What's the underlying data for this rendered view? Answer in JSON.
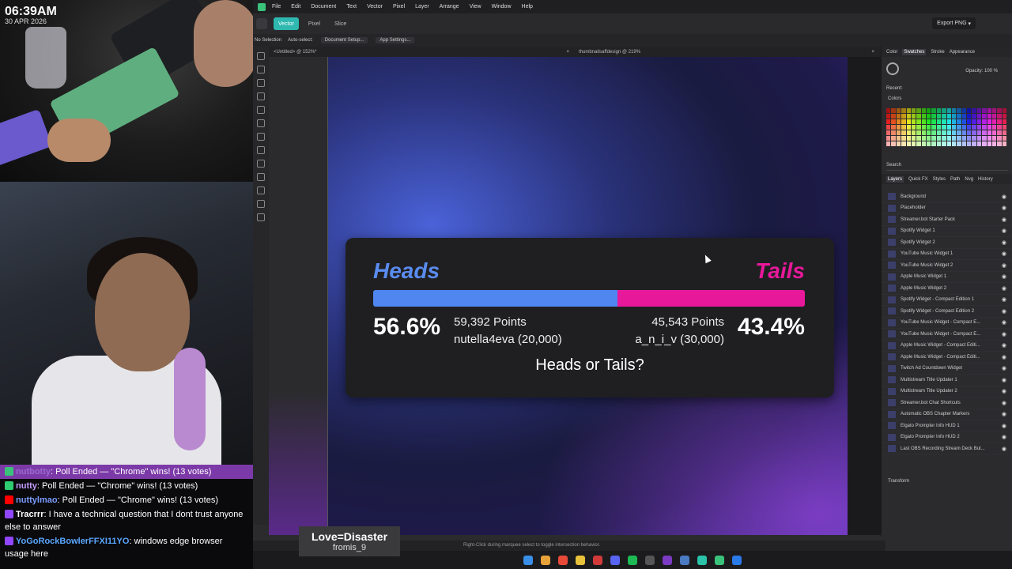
{
  "overlay": {
    "time": "06:39AM",
    "date": "30 APR 2026"
  },
  "chat": [
    {
      "user": "nutbotty",
      "text": ": Poll Ended — \"Chrome\" wins! (13 votes)",
      "user_color": "#9b6bd0",
      "highlight": true
    },
    {
      "user": "nutty",
      "text": ": Poll Ended — \"Chrome\" wins! (13 votes)",
      "user_color": "#c49bff",
      "highlight": false
    },
    {
      "user": "nuttylmao",
      "text": ": Poll Ended — \"Chrome\" wins! (13 votes)",
      "user_color": "#7a9cff",
      "highlight": false
    },
    {
      "user": "Tracrrr",
      "text": ": I have a technical question that I dont trust anyone else to answer",
      "user_color": "#ffffff",
      "highlight": false
    },
    {
      "user": "YoGoRockBowlerFFXI11YO",
      "text": ": windows edge browser usage here",
      "user_color": "#5aa6ff",
      "highlight": false
    }
  ],
  "app": {
    "menu": [
      "File",
      "Edit",
      "Document",
      "Text",
      "Vector",
      "Pixel",
      "Layer",
      "Arrange",
      "View",
      "Window",
      "Help"
    ],
    "personas": [
      "Vector",
      "Pixel",
      "Slice"
    ],
    "export_label": "Export PNG",
    "context": {
      "selection": "No Selection",
      "autoselect": "Auto-select:",
      "doc_setup": "Document Setup...",
      "app_settings": "App Settings..."
    },
    "tabs": [
      "<Untitled> @ 152%*",
      "thumbnailsaffdesign @ 219%"
    ],
    "panel_tabs_top": [
      "Color",
      "Swatches",
      "Stroke",
      "Appearance"
    ],
    "opacity_label": "Opacity:",
    "opacity_value": "100 %",
    "recent_label": "Recent:",
    "colors_label": "Colors",
    "search_placeholder": "Search",
    "panel_tabs_layers": [
      "Layers",
      "Quick FX",
      "Styles",
      "Path",
      "Nvg",
      "History"
    ],
    "layers": [
      "Background",
      "Placeholder",
      "Streamer.bot Starter Pack",
      "Spotify Widget 1",
      "Spotify Widget 2",
      "YouTube Music Widget 1",
      "YouTube Music Widget 2",
      "Apple Music Widget 1",
      "Apple Music Widget 2",
      "Spotify Widget - Compact Edition 1",
      "Spotify Widget - Compact Edition 2",
      "YouTube Music Widget - Compact E...",
      "YouTube Music Widget - Compact E...",
      "Apple Music Widget - Compact Editi...",
      "Apple Music Widget - Compact Editi...",
      "Twitch Ad Countdown Widget",
      "Multistream Title Updater 1",
      "Multistream Title Updater 2",
      "Streamer.bot Chat Shortcuts",
      "Automatic OBS Chapter Markers",
      "Elgato Prompter Info HUD 1",
      "Elgato Prompter Info HUD 2",
      "Last OBS Recording Stream Deck But..."
    ],
    "transform_label": "Transform",
    "status_hint": "Right-Click during marquee select to toggle intersection behavior."
  },
  "poll": {
    "left_label": "Heads",
    "right_label": "Tails",
    "left_percent": "56.6%",
    "right_percent": "43.4%",
    "left_fraction": 0.566,
    "left_points": "59,392 Points",
    "right_points": "45,543 Points",
    "left_top_user": "nutella4eva (20,000)",
    "right_top_user": "a_n_i_v (30,000)",
    "question": "Heads or Tails?",
    "left_color": "#4f86f0",
    "right_color": "#e8189a"
  },
  "now_playing": {
    "title": "Love=Disaster",
    "artist": "fromis_9"
  }
}
